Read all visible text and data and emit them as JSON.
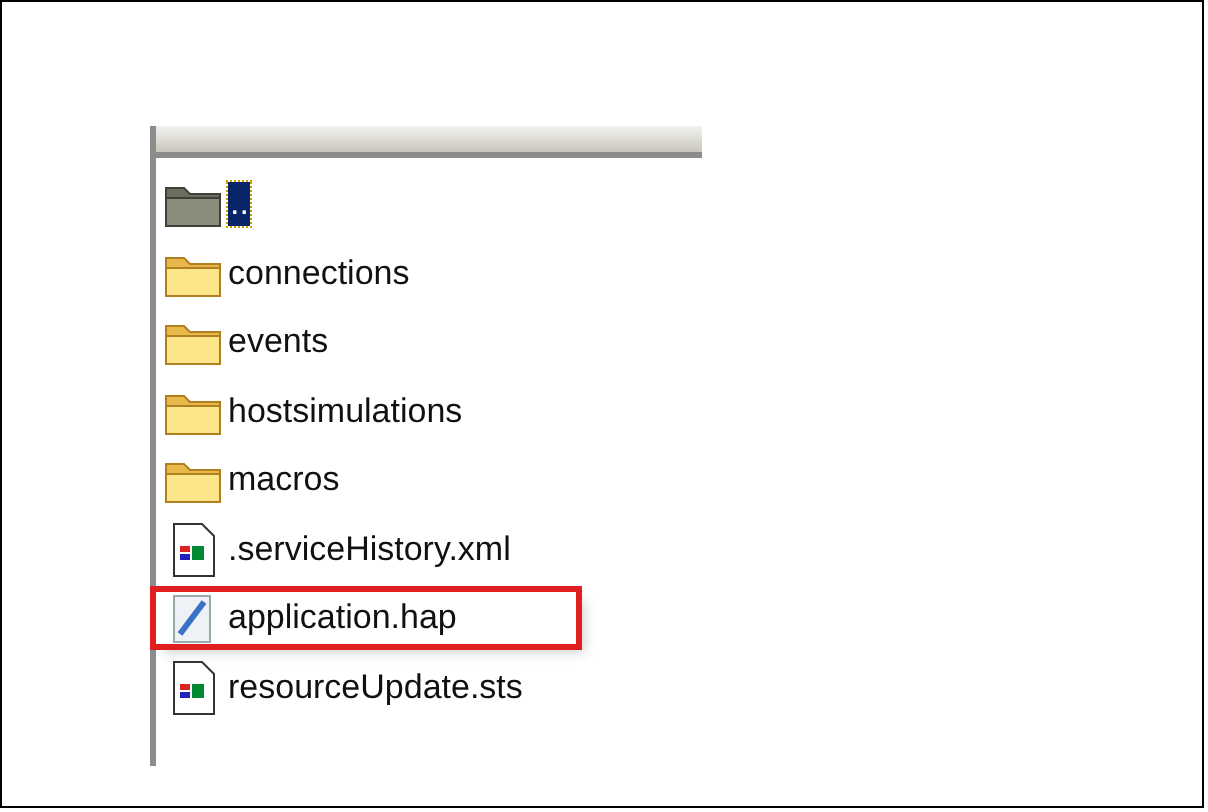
{
  "files": [
    {
      "name": "..",
      "kind": "parent",
      "selected": true,
      "highlighted": false
    },
    {
      "name": "connections",
      "kind": "folder",
      "selected": false,
      "highlighted": false
    },
    {
      "name": "events",
      "kind": "folder",
      "selected": false,
      "highlighted": false
    },
    {
      "name": "hostsimulations",
      "kind": "folder",
      "selected": false,
      "highlighted": false
    },
    {
      "name": "macros",
      "kind": "folder",
      "selected": false,
      "highlighted": false
    },
    {
      "name": ".serviceHistory.xml",
      "kind": "file",
      "selected": false,
      "highlighted": false
    },
    {
      "name": "application.hap",
      "kind": "hap",
      "selected": false,
      "highlighted": true
    },
    {
      "name": "resourceUpdate.sts",
      "kind": "file",
      "selected": false,
      "highlighted": false
    }
  ]
}
